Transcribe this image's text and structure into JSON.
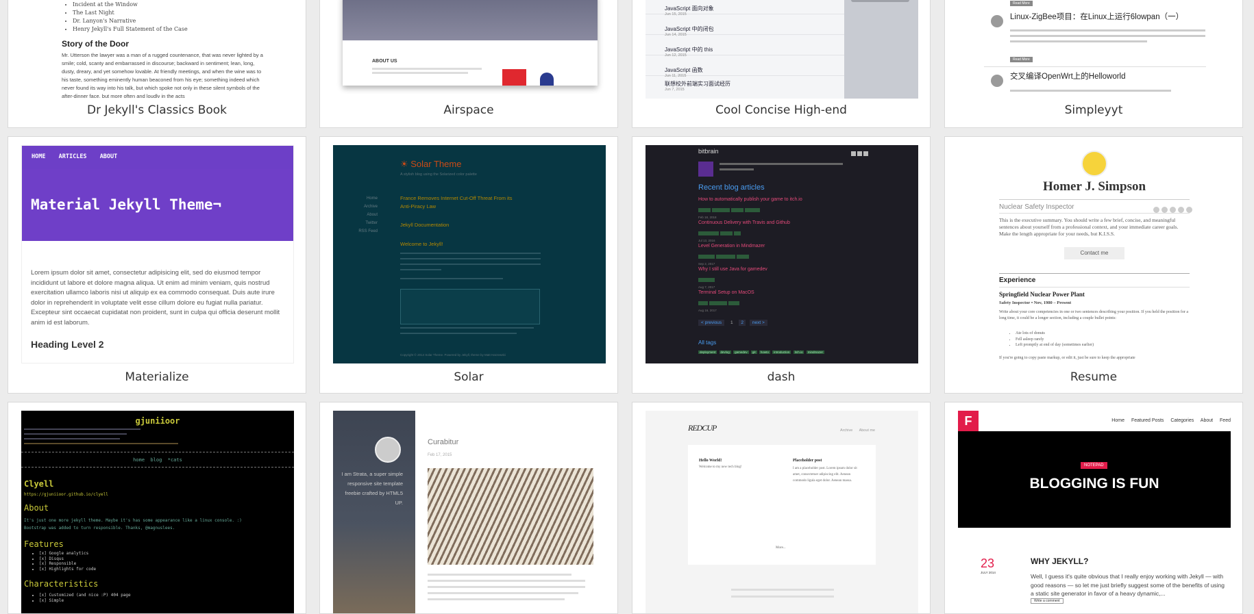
{
  "cards": {
    "jekyll": {
      "title": "Dr Jekyll's Classics Book",
      "list": [
        "Incident at the Window",
        "The Last Night",
        "Dr. Lanyon's Narrative",
        "Henry Jekyll's Full Statement of the Case"
      ],
      "heading": "Story of the Door",
      "body": "Mr. Utterson the lawyer was a man of a rugged countenance, that was never lighted by a smile; cold, scanty and embarrassed in discourse; backward in sentiment; lean, long, dusty, dreary, and yet somehow lovable. At friendly meetings, and when the wine was to his taste, something eminently human beaconed from his eye; something indeed which never found its way into his talk, but which spoke not only in these silent symbols of the after-dinner face, but more often and loudly in the acts"
    },
    "airspace": {
      "title": "Airspace",
      "about": "ABOUT US"
    },
    "cool": {
      "title": "Cool Concise High-end",
      "posts": [
        {
          "t": "JavaScript 面向对象",
          "d": "Jun 15, 2015"
        },
        {
          "t": "JavaScript 中的闭包",
          "d": "Jun 14, 2015"
        },
        {
          "t": "JavaScript 中的 this",
          "d": "Jun 12, 2015"
        },
        {
          "t": "JavaScript 函数",
          "d": "Jun 11, 2015"
        },
        {
          "t": "联想校外前端实习面试经历",
          "d": "Jun 7, 2015"
        }
      ]
    },
    "simpleyyt": {
      "title": "Simpleyyt",
      "p1": "Linux-ZigBee项目：在Linux上运行6lowpan（一）",
      "p2": "交叉编译OpenWrt上的Helloworld",
      "more": "Read More"
    },
    "materialize": {
      "title": "Materialize",
      "nav": [
        "HOME",
        "ARTICLES",
        "ABOUT"
      ],
      "hero": "Material Jekyll Theme¬",
      "body": "Lorem ipsum dolor sit amet, consectetur adipisicing elit, sed do eiusmod tempor incididunt ut labore et dolore magna aliqua. Ut enim ad minim veniam, quis nostrud exercitation ullamco laboris nisi ut aliquip ex ea commodo consequat. Duis aute irure dolor in reprehenderit in voluptate velit esse cillum dolore eu fugiat nulla pariatur. Excepteur sint occaecat cupidatat non proident, sunt in culpa qui officia deserunt mollit anim id est laborum.",
      "h2": "Heading Level 2"
    },
    "solar": {
      "title": "Solar",
      "brand": "☀ Solar Theme",
      "tagline": "A stylish blog using the Solarized color palette",
      "nav": [
        "Home",
        "Archive",
        "About",
        "Twitter",
        "RSS Feed"
      ],
      "p1": "France Removes Internet Cut-Off Threat From its Anti-Piracy Law",
      "p2": "Jekyll Documentation",
      "p3": "Welcome to Jekyll!",
      "footer": "Copyright © 2014 Solar Theme. Powered by Jekyll, theme by Matt Harzewski"
    },
    "dash": {
      "title": "dash",
      "brand": "bitbrain",
      "heading": "Recent blog articles",
      "posts": [
        {
          "t": "How to automatically publish your game to itch.io",
          "d": "Feb 18, 2018"
        },
        {
          "t": "Continuous Delivery with Travis and Github",
          "d": "Jul 13, 2016"
        },
        {
          "t": "Level Generation in Mindmazer",
          "d": "Sep 2, 2017"
        },
        {
          "t": "Why I still use Java for gamedev",
          "d": "Aug 7, 2017"
        },
        {
          "t": "Terminal Setup on MacOS",
          "d": "Aug 16, 2017"
        }
      ],
      "pager": [
        "< previous",
        "1",
        "2",
        "next >"
      ],
      "tags_heading": "All tags",
      "tags": [
        "deployment",
        "devlog",
        "gamedev",
        "git",
        "howto",
        "introduction",
        "itch.io",
        "mindmazer"
      ]
    },
    "resume": {
      "title": "Resume",
      "name": "Homer J. Simpson",
      "role": "Nuclear Safety Inspector",
      "summary": "This is the executive summary. You should write a few brief, concise, and meaningful sentences about yourself from a professional context, and your immediate career goals. Make the length appropriate for your needs, but K.I.S.S.",
      "contact": "Contact me",
      "exp": "Experience",
      "plant": "Springfield Nuclear Power Plant",
      "job": "Safety Inspector • Nov, 1980 – Present",
      "desc": "Write about your core competencies in one or two sentences describing your position. If you held the position for a long time, it could be a longer section, including a couple bullet points:",
      "bullets": [
        "Ate lots of donuts",
        "Fell asleep rarely",
        "Left promptly at end of day (sometimes earlier)"
      ],
      "tail": "If you're going to copy paste markup, or edit it, just be sure to keep the appropriate"
    },
    "gjuniioor": {
      "title": "gjuniioor",
      "nav": "home  blog  *cats",
      "h1": "Clyell",
      "link": "https://gjuniioor.github.io/clyell",
      "about": "About",
      "about_text": "It's just one more jekyll theme. Maybe it's has some appearance like a linux console. :) Bootstrap was added to turn responsible. Thanks, @magnuslees.",
      "features": "Features",
      "feature_list": [
        "[x] Google analytics",
        "[x] Disqus",
        "[x] Responsible",
        "[x] Highlights for code"
      ],
      "chars": "Characteristics",
      "char_list": [
        "[x] Customized (and nice :P) 404 page",
        "[x] Simple"
      ]
    },
    "strata": {
      "title": "Curabitur",
      "date": "Feb 17, 2015",
      "intro": "I am Strata, a super simple responsive site template freebie crafted by HTML5 UP."
    },
    "redcup": {
      "logo": "REDCUP",
      "nav": [
        "Archive",
        "About me"
      ],
      "post1_title": "Hello World!",
      "post1_text": "Welcome to my new tech blog!",
      "post2_title": "Placeholder post",
      "post2_text": "I am a placeholder post. Lorem ipsum dolor sit amet, consectetuer adipiscing elit. Aenean commodo ligula eget dolor. Aenean massa.",
      "more": "More..."
    },
    "featured": {
      "logo": "F",
      "nav": [
        "Home",
        "Featured Posts",
        "Categories",
        "About",
        "Feed"
      ],
      "badge": "NOTEPAD",
      "hero": "BLOGGING IS FUN",
      "day": "23",
      "month": "JULY 2014",
      "post_title": "WHY JEKYLL?",
      "post_text": "Well, I guess it's quite obvious that I really enjoy working with Jekyll — with good reasons — so let me just briefly suggest some of the benefits of using a static site generator in favor of a heavy dynamic,...",
      "comment": "Write a comment"
    }
  }
}
